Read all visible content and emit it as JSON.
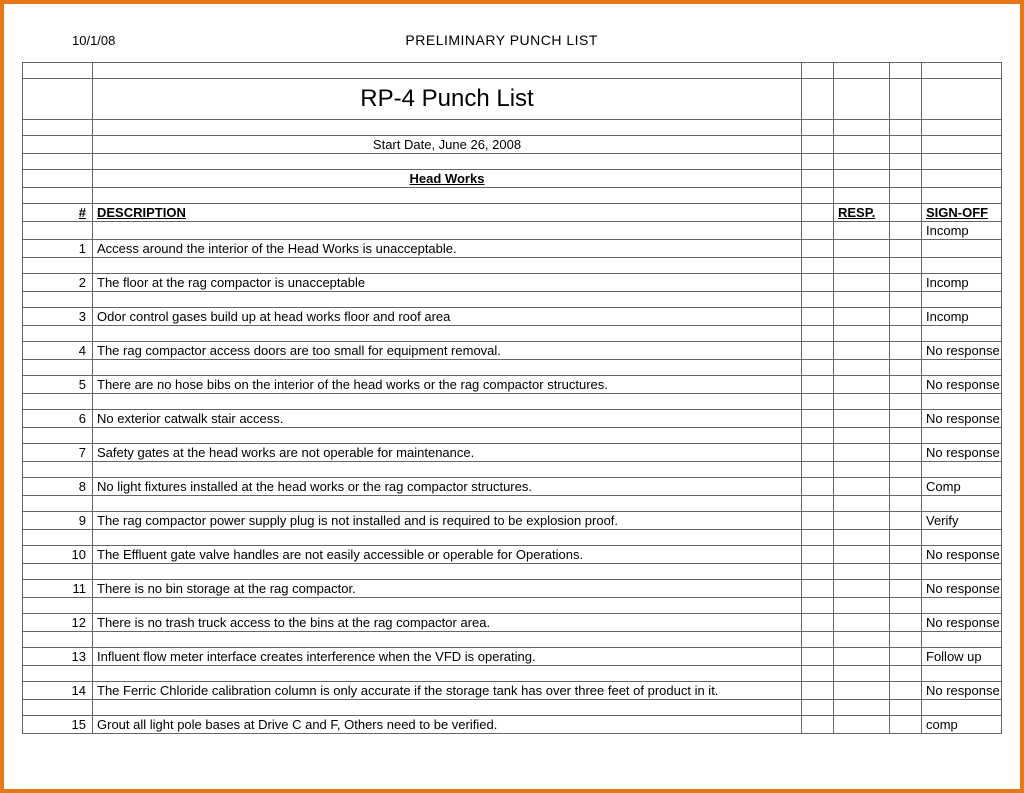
{
  "header": {
    "date": "10/1/08",
    "title": "PRELIMINARY PUNCH LIST"
  },
  "doc_title": "RP-4 Punch List",
  "start_date_line": "Start Date, June 26, 2008",
  "section_heading": "Head Works",
  "columns": {
    "num": "#",
    "desc": "DESCRIPTION",
    "resp": "RESP.",
    "sign": "SIGN-OFF"
  },
  "pre_rows": {
    "signoff_first": "Incomp"
  },
  "items": [
    {
      "num": "1",
      "desc": "Access around the interior of the Head Works is unacceptable.",
      "sign": ""
    },
    {
      "num": "2",
      "desc": "The floor at the rag compactor is unacceptable",
      "sign": "Incomp"
    },
    {
      "num": "3",
      "desc": "Odor control gases build up at head works floor and roof area",
      "sign": "Incomp"
    },
    {
      "num": "4",
      "desc": "The rag compactor access doors are too small for equipment removal.",
      "sign": "No response"
    },
    {
      "num": "5",
      "desc": "There are no hose bibs on the interior of the head works or the rag compactor structures.",
      "sign": "No response"
    },
    {
      "num": "6",
      "desc": "No exterior catwalk stair access.",
      "sign": "No response"
    },
    {
      "num": "7",
      "desc": "Safety gates at the head works are not operable for maintenance.",
      "sign": "No response"
    },
    {
      "num": "8",
      "desc": "No light fixtures installed at the head works or the rag compactor structures.",
      "sign": "Comp"
    },
    {
      "num": "9",
      "desc": "The rag compactor power supply plug is not installed and is required to be explosion proof.",
      "sign": "Verify"
    },
    {
      "num": "10",
      "desc": "The Effluent gate valve handles are not easily accessible or operable for Operations.",
      "sign": "No response"
    },
    {
      "num": "11",
      "desc": "There is no bin storage at the rag compactor.",
      "sign": "No response"
    },
    {
      "num": "12",
      "desc": "There is no trash truck access to the bins at the rag compactor area.",
      "sign": "No response"
    },
    {
      "num": "13",
      "desc": "Influent flow meter interface creates interference when the VFD is operating.",
      "sign": "Follow up"
    },
    {
      "num": "14",
      "desc": "The Ferric Chloride calibration column is only accurate if the storage tank has over three feet of product in it.",
      "sign": "No response"
    },
    {
      "num": "15",
      "desc": "Grout all light pole bases at Drive C and F, Others need to be verified.",
      "sign": "comp"
    }
  ]
}
